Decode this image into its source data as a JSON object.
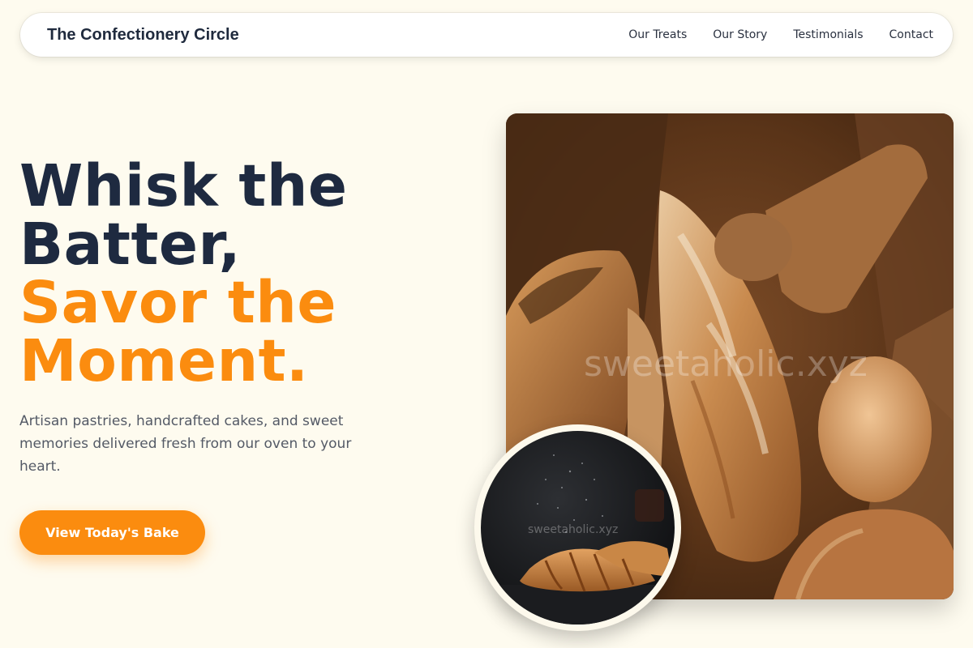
{
  "nav": {
    "brand": "The Confectionery Circle",
    "links": [
      "Our Treats",
      "Our Story",
      "Testimonials",
      "Contact"
    ]
  },
  "hero": {
    "title_line1": "Whisk the",
    "title_line2": "Batter,",
    "title_line3": "Savor the",
    "title_line4": "Moment.",
    "subtitle": "Artisan pastries, handcrafted cakes, and sweet memories delivered fresh from our oven to your heart.",
    "cta_label": "View Today's Bake"
  },
  "images": {
    "main_alt": "Rustic bread loaves in a paper bag",
    "main_watermark": "sweetaholic.xyz",
    "inset_alt": "Croissants dusted with flour",
    "inset_watermark": "sweetaholic.xyz"
  },
  "colors": {
    "background": "#fefbef",
    "accent": "#fb8c0f",
    "heading": "#1e2a40",
    "body_text": "#545a66"
  }
}
